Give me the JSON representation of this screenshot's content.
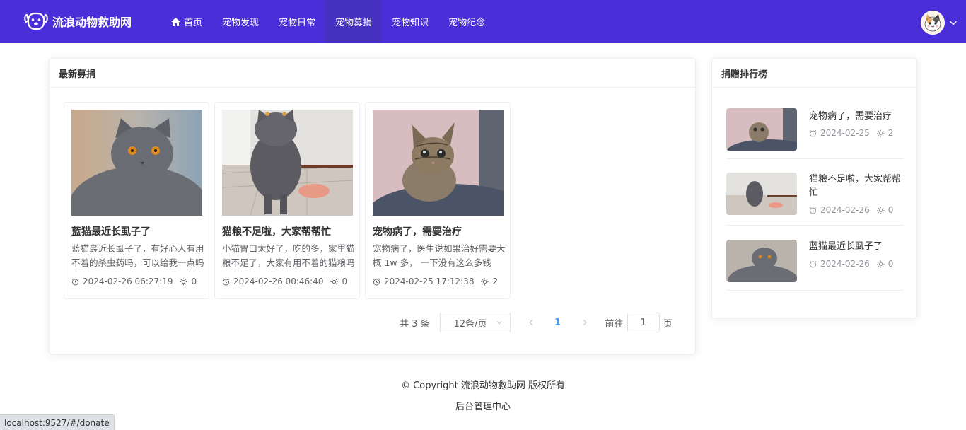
{
  "brand": {
    "name": "流浪动物救助网"
  },
  "nav": {
    "items": [
      {
        "label": "首页"
      },
      {
        "label": "宠物发现"
      },
      {
        "label": "宠物日常"
      },
      {
        "label": "宠物募捐"
      },
      {
        "label": "宠物知识"
      },
      {
        "label": "宠物纪念"
      }
    ],
    "active": "宠物募捐"
  },
  "main": {
    "title": "最新募捐",
    "cards": [
      {
        "title": "蓝猫最近长虱子了",
        "desc": "蓝猫最近长虱子了，有好心人有用不着的杀虫药吗，可以给我一点吗",
        "time": "2024-02-26 06:27:19",
        "likes": "0"
      },
      {
        "title": "猫粮不足啦，大家帮帮忙",
        "desc": "小猫胃口太好了，吃的多，家里猫粮不足了，大家有用不着的猫粮吗",
        "time": "2024-02-26 00:46:40",
        "likes": "0"
      },
      {
        "title": "宠物病了，需要治疗",
        "desc": "宠物病了，医生说如果治好需要大概 1w 多， 一下没有这么多钱",
        "time": "2024-02-25 17:12:38",
        "likes": "2"
      }
    ],
    "pagination": {
      "total": "共 3 条",
      "page_size": "12条/页",
      "current": "1",
      "goto_prefix": "前往",
      "goto_value": "1",
      "goto_suffix": "页"
    }
  },
  "ranking": {
    "title": "捐赠排行榜",
    "items": [
      {
        "title": "宠物病了，需要治疗",
        "date": "2024-02-25",
        "likes": "2"
      },
      {
        "title": "猫粮不足啦，大家帮帮忙",
        "date": "2024-02-26",
        "likes": "0"
      },
      {
        "title": "蓝猫最近长虱子了",
        "date": "2024-02-26",
        "likes": "0"
      }
    ]
  },
  "footer": {
    "copyright": "© Copyright 流浪动物救助网 版权所有",
    "admin_link": "后台管理中心"
  },
  "statusbar": {
    "url": "localhost:9527/#/donate"
  },
  "colors": {
    "header": "#4a2fd8",
    "accent": "#409eff"
  },
  "icons": [
    "dog-logo-icon",
    "home-icon",
    "chevron-down-icon",
    "alarm-clock-icon",
    "sun-like-icon",
    "chevron-left-icon",
    "chevron-right-icon"
  ]
}
